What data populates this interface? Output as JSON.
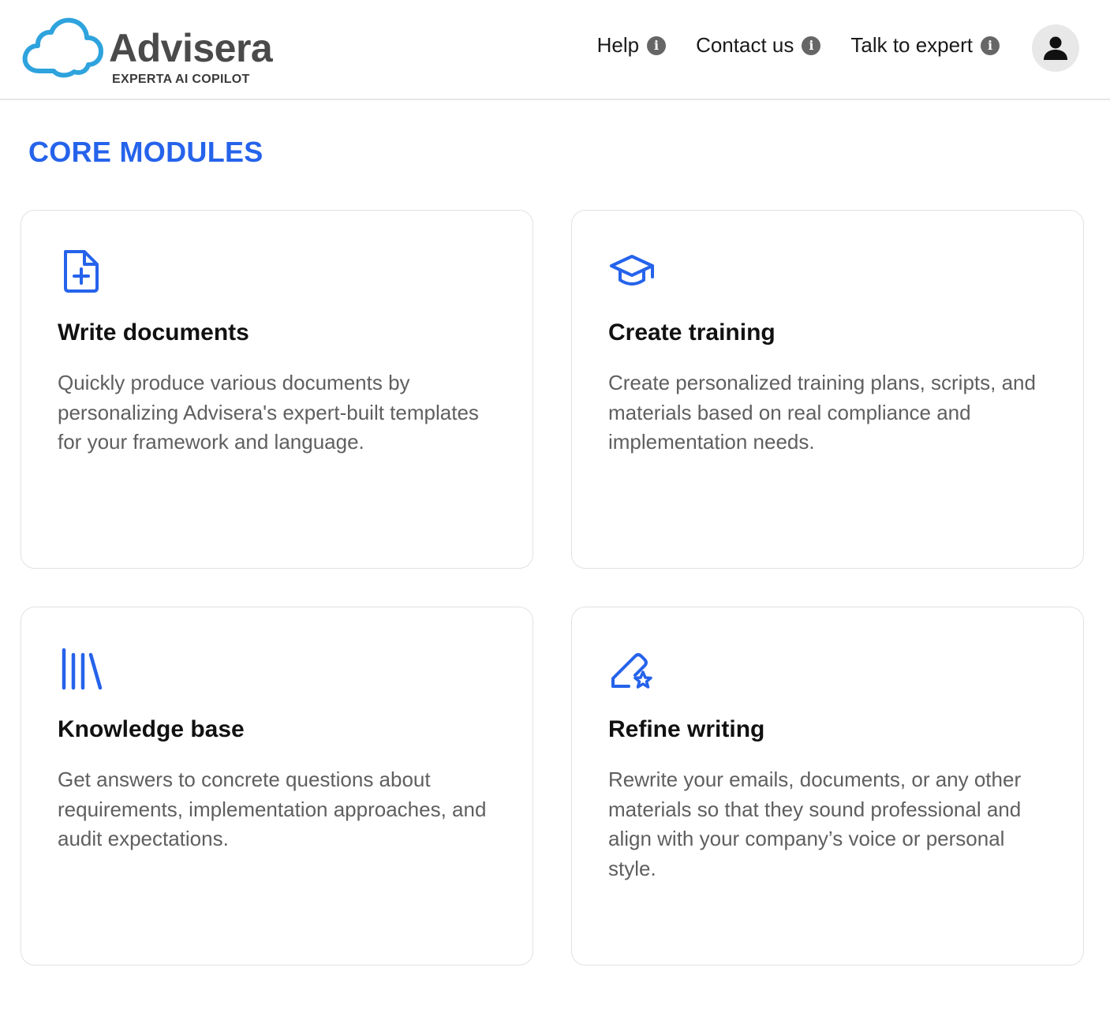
{
  "brand": {
    "name": "Advisera",
    "subtitle": "EXPERTA AI COPILOT",
    "accent_color": "#2563eb",
    "logo_icon": "cloud-logo-icon"
  },
  "nav": {
    "items": [
      {
        "label": "Help",
        "icon": "info-icon"
      },
      {
        "label": "Contact us",
        "icon": "info-icon"
      },
      {
        "label": "Talk to expert",
        "icon": "info-icon"
      }
    ],
    "avatar_icon": "user-icon"
  },
  "section": {
    "title": "CORE MODULES"
  },
  "modules": [
    {
      "icon": "document-plus-icon",
      "title": "Write documents",
      "description": "Quickly produce various documents by personalizing Advisera's expert-built templates for your framework and language."
    },
    {
      "icon": "graduation-cap-icon",
      "title": "Create training",
      "description": "Create personalized training plans, scripts, and materials based on real compliance and implementation needs."
    },
    {
      "icon": "library-icon",
      "title": "Knowledge base",
      "description": "Get answers to concrete questions about requirements, implementation approaches, and audit expectations."
    },
    {
      "icon": "pencil-star-icon",
      "title": "Refine writing",
      "description": "Rewrite your emails, documents, or any other materials so that they sound professional and align with your company’s voice or personal style."
    }
  ]
}
